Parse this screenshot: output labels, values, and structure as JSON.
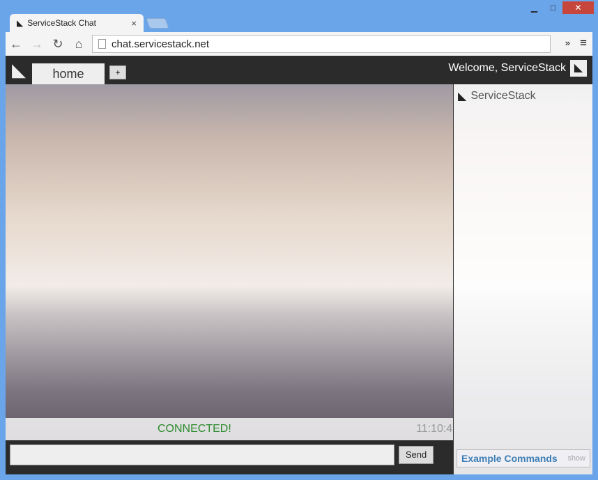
{
  "browser": {
    "tab_title": "ServiceStack Chat",
    "url": "chat.servicestack.net",
    "controls": {
      "minimize": "▁",
      "maximize": "□",
      "close": "✕"
    }
  },
  "app": {
    "channel_tab": "home",
    "add_channel": "+",
    "welcome": "Welcome, ServiceStack",
    "users": [
      "ServiceStack"
    ],
    "status": "CONNECTED!",
    "timestamp": "11:10:4",
    "send_label": "Send",
    "example_commands": "Example Commands",
    "show_label": "show",
    "message_placeholder": ""
  }
}
